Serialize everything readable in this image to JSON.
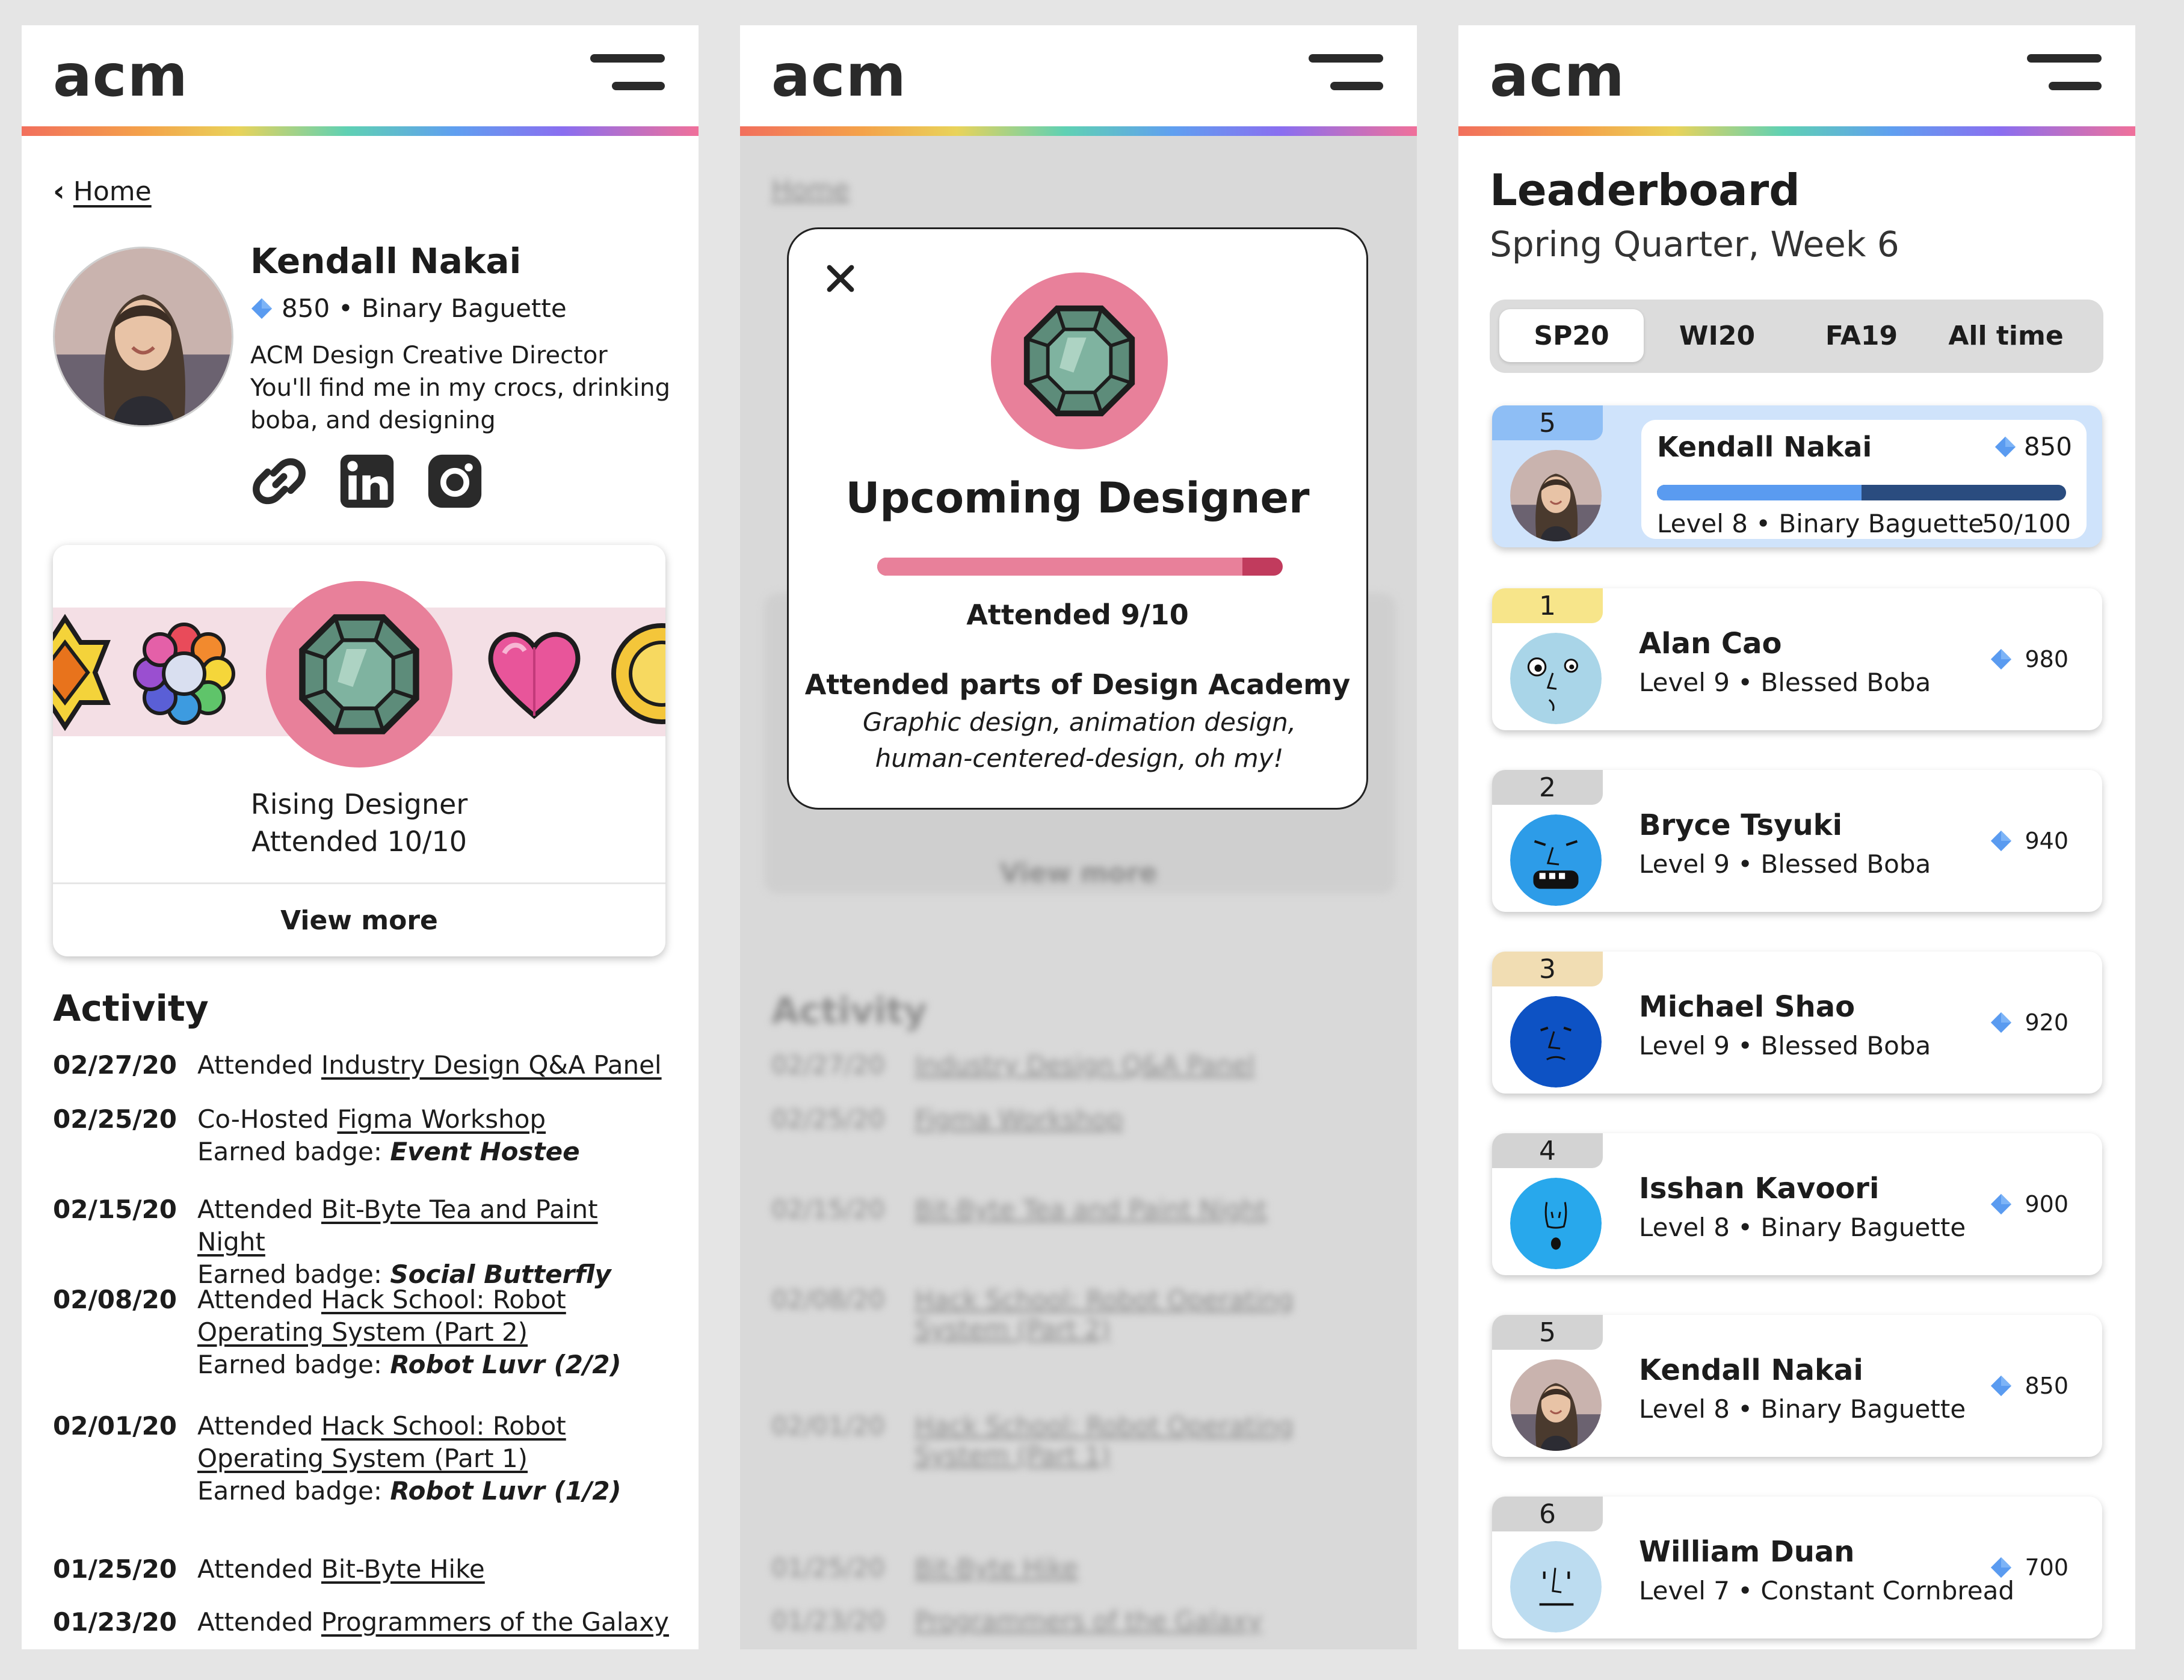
{
  "brand": {
    "logo": "acm"
  },
  "profile": {
    "back_label": "Home",
    "name": "Kendall Nakai",
    "score": "850",
    "rank_title": "Binary Baguette",
    "bio_line1": "ACM Design Creative Director",
    "bio_line2": "You'll find me in my crocs, drinking boba, and designing",
    "badge_card": {
      "title": "Rising Designer",
      "attended": "Attended 10/10",
      "view_more": "View more"
    },
    "activity_title": "Activity",
    "activity": [
      {
        "date": "02/27/20",
        "verb": "Attended ",
        "event": "Industry Design Q&A Panel",
        "badge_prefix": "",
        "badge": ""
      },
      {
        "date": "02/25/20",
        "verb": "Co-Hosted ",
        "event": "Figma Workshop",
        "badge_prefix": "Earned badge: ",
        "badge": "Event Hostee"
      },
      {
        "date": "02/15/20",
        "verb": "Attended ",
        "event": "Bit-Byte Tea and Paint Night",
        "badge_prefix": "Earned badge: ",
        "badge": "Social Butterfly"
      },
      {
        "date": "02/08/20",
        "verb": "Attended ",
        "event": "Hack School: Robot Operating System (Part 2)",
        "badge_prefix": "Earned badge: ",
        "badge": "Robot Luvr (2/2)"
      },
      {
        "date": "02/01/20",
        "verb": "Attended ",
        "event": "Hack School: Robot Operating System (Part 1)",
        "badge_prefix": "Earned badge: ",
        "badge": "Robot Luvr (1/2)"
      },
      {
        "date": "01/25/20",
        "verb": "Attended ",
        "event": "Bit-Byte Hike",
        "badge_prefix": "",
        "badge": ""
      },
      {
        "date": "01/23/20",
        "verb": "Attended ",
        "event": "Programmers of the Galaxy",
        "badge_prefix": "",
        "badge": ""
      }
    ]
  },
  "modal": {
    "title": "Upcoming Designer",
    "attended": "Attended 9/10",
    "progress_fraction": 0.9,
    "desc_title": "Attended parts of Design Academy",
    "desc": "Graphic design, animation design, human-centered-design, oh my!"
  },
  "leaderboard": {
    "title": "Leaderboard",
    "subtitle": "Spring Quarter, Week 6",
    "tabs": [
      "SP20",
      "WI20",
      "FA19",
      "All time"
    ],
    "active_tab": "SP20",
    "me": {
      "rank": "5",
      "name": "Kendall Nakai",
      "score": "850",
      "level": "Level 8 • Binary Baguette",
      "progress": "50/100",
      "progress_fraction": 0.5
    },
    "entries": [
      {
        "rank": "1",
        "name": "Alan Cao",
        "level": "Level 9 • Blessed Boba",
        "score": "980",
        "rank_color": "#f7e58a",
        "avatar": "light-blue-face"
      },
      {
        "rank": "2",
        "name": "Bryce Tsyuki",
        "level": "Level 9 • Blessed Boba",
        "score": "940",
        "rank_color": "#d3d3d3",
        "avatar": "blue-face"
      },
      {
        "rank": "3",
        "name": "Michael Shao",
        "level": "Level 9 • Blessed Boba",
        "score": "920",
        "rank_color": "#f1ddb3",
        "avatar": "dark-blue-face"
      },
      {
        "rank": "4",
        "name": "Isshan Kavoori",
        "level": "Level 8 • Binary Baguette",
        "score": "900",
        "rank_color": "#d3d3d3",
        "avatar": "sky-blue-face"
      },
      {
        "rank": "5",
        "name": "Kendall Nakai",
        "level": "Level 8 • Binary Baguette",
        "score": "850",
        "rank_color": "#d3d3d3",
        "avatar": "photo"
      },
      {
        "rank": "6",
        "name": "William Duan",
        "level": "Level 7 • Constant Cornbread",
        "score": "700",
        "rank_color": "#d3d3d3",
        "avatar": "pale-blue-face"
      }
    ]
  },
  "colors": {
    "gem_blue": "#5a9bf0",
    "badge_pink": "#e8809a",
    "progress_dark": "#c13b5d"
  }
}
